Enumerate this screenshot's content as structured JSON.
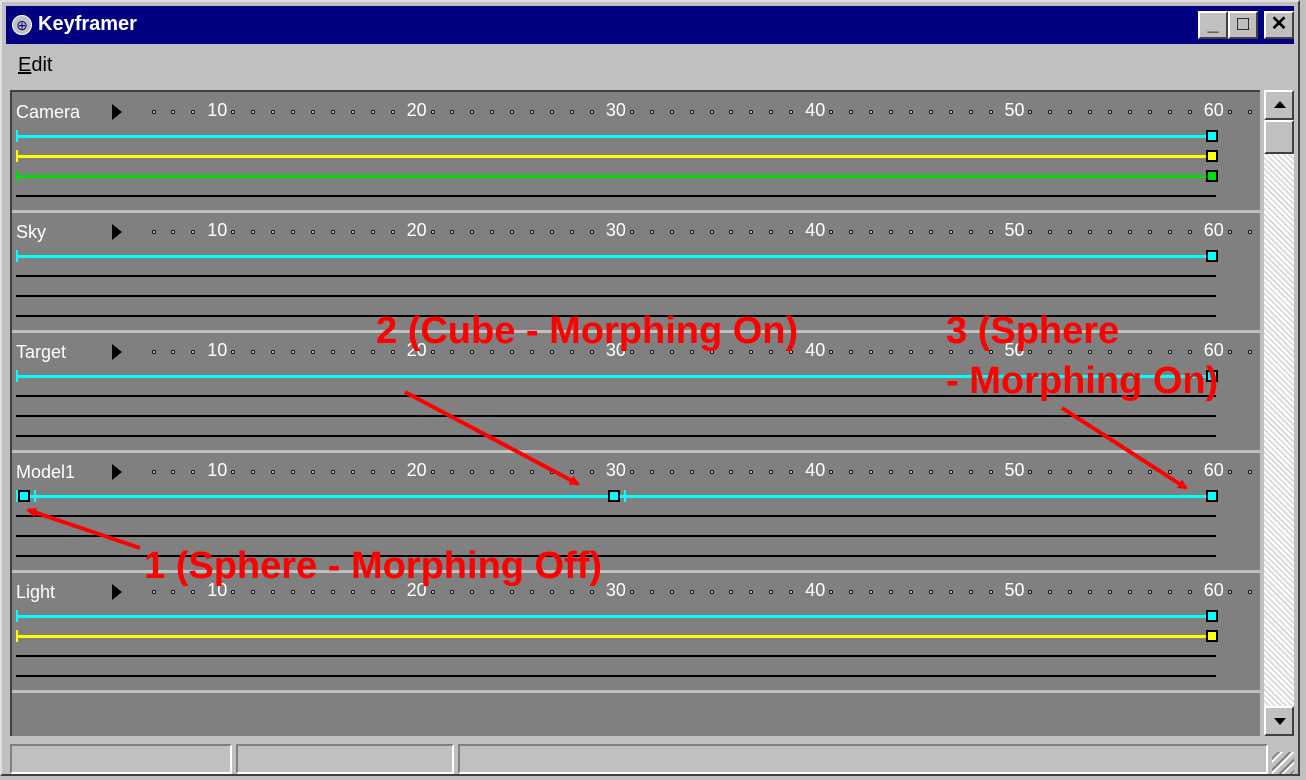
{
  "window": {
    "title": "Keyframer",
    "minimize": "_",
    "maximize": "□",
    "close": "✕"
  },
  "menu": {
    "edit_underlined": "E",
    "edit_rest": "dit"
  },
  "ruler": {
    "ticks": [
      "10",
      "20",
      "30",
      "40",
      "50",
      "60"
    ]
  },
  "colors": {
    "cyan": "#00ffff",
    "yellow": "#ffff00",
    "green": "#00e000",
    "annotation": "#ff0000",
    "pane": "#808080"
  },
  "tracks": [
    {
      "label": "Camera",
      "channels": [
        {
          "color": "cyan",
          "keys": [
            60
          ]
        },
        {
          "color": "yellow",
          "keys": [
            60
          ]
        },
        {
          "color": "green",
          "keys": [
            60
          ]
        }
      ]
    },
    {
      "label": "Sky",
      "channels": [
        {
          "color": "cyan",
          "keys": [
            60
          ]
        }
      ]
    },
    {
      "label": "Target",
      "channels": [
        {
          "color": "cyan",
          "keys": [
            60
          ]
        }
      ]
    },
    {
      "label": "Model1",
      "channels": [
        {
          "color": "cyan",
          "keys": [
            0,
            30,
            60
          ]
        }
      ]
    },
    {
      "label": "Light",
      "channels": [
        {
          "color": "cyan",
          "keys": [
            60
          ]
        },
        {
          "color": "yellow",
          "keys": [
            60
          ]
        }
      ]
    }
  ],
  "annotations": {
    "a1": "1 (Sphere - Morphing Off)",
    "a2": "2 (Cube - Morphing On)",
    "a3_line1": "3 (Sphere",
    "a3_line2": "- Morphing On)"
  },
  "statusbar": {
    "panels": [
      "",
      "",
      ""
    ]
  }
}
